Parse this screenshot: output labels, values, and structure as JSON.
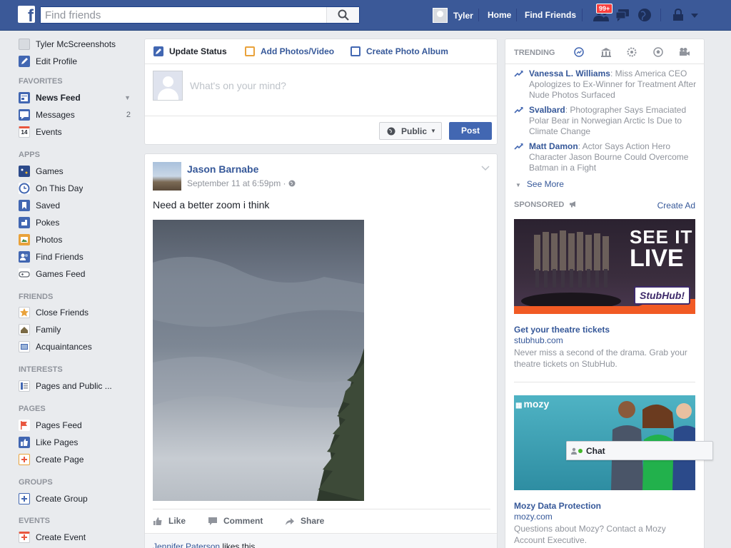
{
  "topbar": {
    "search_placeholder": "Find friends",
    "user_name": "Tyler",
    "home": "Home",
    "find_friends": "Find Friends",
    "badge": "99+"
  },
  "leftnav": {
    "profile_name": "Tyler McScreenshots",
    "edit_profile": "Edit Profile",
    "favorites_head": "FAVORITES",
    "news_feed": "News Feed",
    "messages": "Messages",
    "messages_count": "2",
    "events": "Events",
    "events_day": "14",
    "apps_head": "APPS",
    "games": "Games",
    "on_this_day": "On This Day",
    "saved": "Saved",
    "pokes": "Pokes",
    "photos": "Photos",
    "find_friends": "Find Friends",
    "games_feed": "Games Feed",
    "friends_head": "FRIENDS",
    "close_friends": "Close Friends",
    "family": "Family",
    "acquaintances": "Acquaintances",
    "interests_head": "INTERESTS",
    "pages_public": "Pages and Public ...",
    "pages_head": "PAGES",
    "pages_feed": "Pages Feed",
    "like_pages": "Like Pages",
    "create_page": "Create Page",
    "groups_head": "GROUPS",
    "create_group": "Create Group",
    "events_head": "EVENTS",
    "create_event": "Create Event"
  },
  "composer": {
    "tab_status": "Update Status",
    "tab_photos": "Add Photos/Video",
    "tab_album": "Create Photo Album",
    "placeholder": "What's on your mind?",
    "public": "Public",
    "post": "Post"
  },
  "post": {
    "author": "Jason Barnabe",
    "time": "September 11 at 6:59pm · ",
    "text": "Need a better zoom i think",
    "like": "Like",
    "comment": "Comment",
    "share": "Share",
    "liker": "Jennifer Paterson",
    "likes_suffix": " likes this."
  },
  "trending": {
    "head": "TRENDING",
    "items": [
      {
        "name": "Vanessa L. Williams",
        "desc": ": Miss America CEO Apologizes to Ex-Winner for Treatment After Nude Photos Surfaced"
      },
      {
        "name": "Svalbard",
        "desc": ": Photographer Says Emaciated Polar Bear in Norwegian Arctic Is Due to Climate Change"
      },
      {
        "name": "Matt Damon",
        "desc": ": Actor Says Action Hero Character Jason Bourne Could Overcome Batman in a Fight"
      }
    ],
    "see_more": "See More"
  },
  "sponsored": {
    "head": "SPONSORED",
    "create_ad": "Create Ad",
    "ads": [
      {
        "image_text_1": "SEE IT",
        "image_text_2": "LIVE",
        "image_brand": "StubHub!",
        "title": "Get your theatre tickets",
        "url": "stubhub.com",
        "desc": "Never miss a second of the drama. Grab your theatre tickets on StubHub."
      },
      {
        "image_brand": "mozy",
        "title": "Mozy Data Protection",
        "url": "mozy.com",
        "desc": "Questions about Mozy? Contact a Mozy Account Executive."
      }
    ]
  },
  "chat": {
    "label": "Chat"
  },
  "colors": {
    "brand": "#3b5998",
    "link": "#365899",
    "post_button": "#4267b2",
    "badge": "#fa3e3e"
  }
}
